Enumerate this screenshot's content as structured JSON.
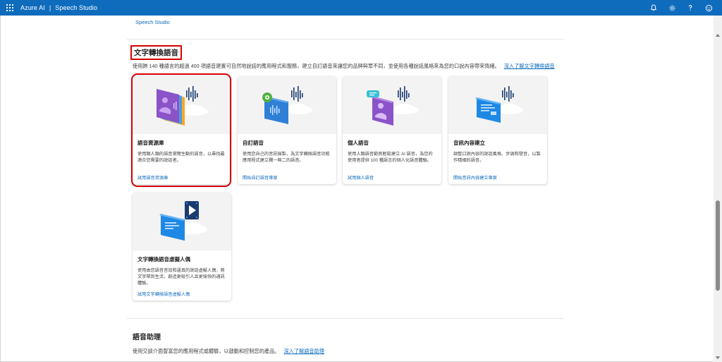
{
  "topbar": {
    "product": "Azure AI",
    "separator": "|",
    "app": "Speech Studio",
    "icons": [
      "bell-icon",
      "gear-icon",
      "help-icon",
      "smiley-icon"
    ]
  },
  "breadcrumb": {
    "link": "Speech Studio"
  },
  "section": {
    "title": "文字轉換語音",
    "description": "使用跨 140 種語言的超過 400 項語音建置可自然地說話的應用程式和服務，建立自訂語音來讓您的品牌與眾不同，並使用各種說話風格來為您的口說內容帶來情緒。",
    "learn_more": "深入了解文字轉換語音"
  },
  "cards": [
    {
      "title": "語音資源庫",
      "description": "使用類人類的語音瀏覽生動的語音，以尋找最適合您需要的說話者。",
      "link": "試用語音資源庫",
      "icon": "voice-gallery-icon"
    },
    {
      "title": "自訂語音",
      "description": "使用您自己的音訊錄製，為文字轉換語音功能應用程式建立獨一無二的語音。",
      "link": "開始自訂語音專案",
      "icon": "custom-voice-icon"
    },
    {
      "title": "個人語音",
      "description": "使用人類語音範例輕鬆建立 AI 語音，為您的使用者提供 100 種語言的個人化語音體驗。",
      "link": "試用個人語音",
      "icon": "personal-voice-icon"
    },
    {
      "title": "音訊內容建立",
      "description": "調整口說內容的說話風格、步調和發音，以製作精細的語音。",
      "link": "開始音訊內容建立專案",
      "icon": "audio-content-icon"
    },
    {
      "title": "文字轉換語音虛擬人偶",
      "description": "使用由您語音音效和逼真的說話虛擬人偶，將文字帶到生活，創造更吸引人且更愉快的通訊體驗。",
      "link": "試用文字轉換語音虛擬人偶",
      "icon": "avatar-icon"
    }
  ],
  "section2": {
    "title": "語音助理",
    "description": "使用交談介面豐富您的應用程式或體驗，以啟動和控制您的產品。",
    "learn_more": "深入了解語音助理"
  },
  "colors": {
    "brand": "#0f6cbd",
    "highlight": "#d40000",
    "card_art_bg": "#f3f3f3"
  }
}
